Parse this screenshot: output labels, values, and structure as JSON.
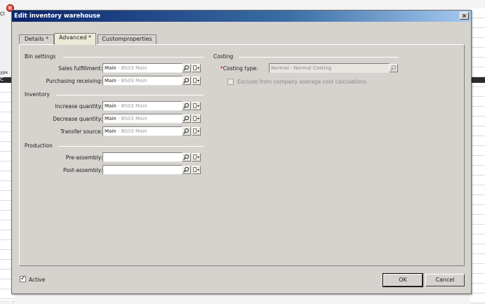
{
  "background": {
    "fragment_top": "Cl",
    "fragment_mid": "ype",
    "fragment_dark": "C"
  },
  "dialog": {
    "title": "Edit inventory warehouse",
    "close_symbol": "×"
  },
  "tabs": [
    {
      "label": "Details *"
    },
    {
      "label": "Advanced *"
    },
    {
      "label": "Customproperties"
    }
  ],
  "bin_settings": {
    "title": "Bin settings",
    "sales_fulfillment": {
      "label": "Sales fulfillment:",
      "main": "Main",
      "sub": " - BS03 Main"
    },
    "purchasing_receiving": {
      "label": "Purchasing receiving:",
      "main": "Main",
      "sub": " - BS03 Main"
    }
  },
  "inventory": {
    "title": "Inventory",
    "increase_quantity": {
      "label": "Increase quantity:",
      "main": "Main",
      "sub": " - BS03 Main"
    },
    "decrease_quantity": {
      "label": "Decrease quantity:",
      "main": "Main",
      "sub": " - BS03 Main"
    },
    "transfer_source": {
      "label": "Transfer source:",
      "main": "Main",
      "sub": " - BS03 Main"
    }
  },
  "production": {
    "title": "Production",
    "pre_assembly": {
      "label": "Pre-assembly:",
      "main": "",
      "sub": ""
    },
    "post_assembly": {
      "label": "Post-assembly:",
      "main": "",
      "sub": ""
    }
  },
  "costing": {
    "title": "Costing",
    "costing_type": {
      "required_mark": "*",
      "label": "Costing type:",
      "value": "Normal - Normal Costing"
    },
    "exclude_label": "Exclude from company average cost calculations",
    "exclude_checked": false
  },
  "footer": {
    "active_label": "Active",
    "active_checked": true,
    "ok_label": "OK",
    "cancel_label": "Cancel"
  },
  "icons": {
    "lookup": "magnifier-icon",
    "menu": "dropdown-menu-icon"
  }
}
